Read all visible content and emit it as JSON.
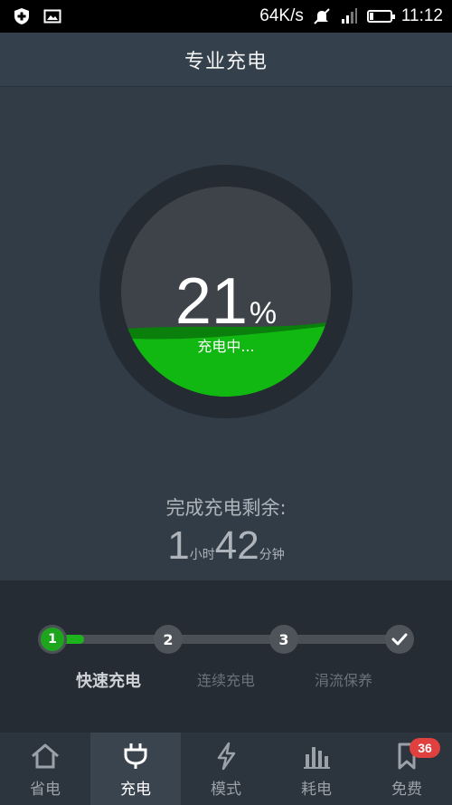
{
  "status_bar": {
    "network_speed": "64K/s",
    "time": "11:12",
    "battery_level": 0.21,
    "icons": [
      "shield-plus-icon",
      "image-icon",
      "mute-icon",
      "signal-icon",
      "battery-icon"
    ]
  },
  "header": {
    "title": "专业充电"
  },
  "gauge": {
    "percent": "21",
    "percent_sign": "%",
    "status": "充电中...",
    "level": 0.21
  },
  "remaining": {
    "label": "完成充电剩余:",
    "hours": "1",
    "hours_unit": "小时",
    "minutes": "42",
    "minutes_unit": "分钟"
  },
  "stages": {
    "progress": 0.09,
    "nodes": [
      {
        "label": "1",
        "active": true
      },
      {
        "label": "2",
        "active": false
      },
      {
        "label": "3",
        "active": false
      },
      {
        "label": "",
        "icon": "check-icon",
        "active": false
      }
    ],
    "labels": [
      "快速充电",
      "连续充电",
      "涓流保养"
    ]
  },
  "nav": {
    "items": [
      {
        "label": "省电",
        "icon": "home-icon"
      },
      {
        "label": "充电",
        "icon": "plug-icon",
        "active": true
      },
      {
        "label": "模式",
        "icon": "lightning-icon"
      },
      {
        "label": "耗电",
        "icon": "bar-chart-icon"
      },
      {
        "label": "免费",
        "icon": "bookmark-icon",
        "badge": "36"
      }
    ]
  },
  "colors": {
    "accent_green": "#1db31d",
    "badge_red": "#e0403e",
    "background": "#323c47"
  }
}
